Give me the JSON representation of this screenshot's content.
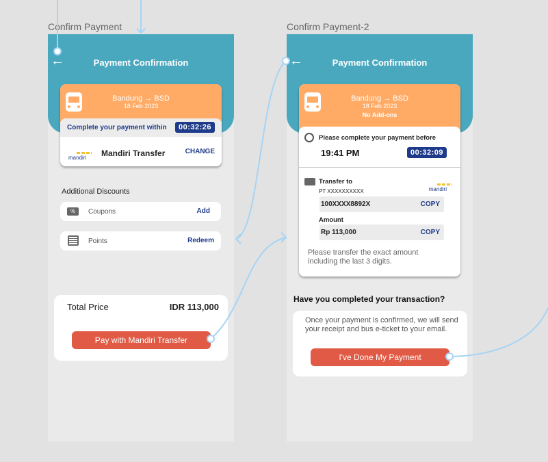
{
  "frames": [
    {
      "title": "Confirm Payment",
      "header": "Payment Confirmation",
      "route": "Bandung → BSD",
      "date": "18 Feb 2023",
      "countdown_label": "Complete your payment within",
      "countdown": "00:32:26",
      "method": "Mandiri Transfer",
      "bank_logo": "mandiri",
      "change": "CHANGE",
      "discounts_title": "Additional Discounts",
      "coupons": {
        "label": "Coupons",
        "action": "Add"
      },
      "points": {
        "label": "Points",
        "action": "Redeem"
      },
      "total_label": "Total Price",
      "total": "IDR 113,000",
      "pay_button": "Pay with Mandiri Transfer"
    },
    {
      "title": "Confirm Payment-2",
      "header": "Payment Confirmation",
      "route": "Bandung → BSD",
      "date": "18 Feb 2023",
      "addons": "No Add-ons",
      "deadline_label": "Please complete your payment before",
      "deadline": "19:41 PM",
      "countdown": "00:32:09",
      "transfer_to": "Transfer to",
      "recipient": "PT XXXXXXXXXX",
      "bank_logo": "mandiri",
      "account": "100XXXX8892X",
      "copy": "COPY",
      "amount_label": "Amount",
      "amount": "Rp 113,000",
      "note": "Please transfer the exact amount including the last 3 digits.",
      "question": "Have you completed your transaction?",
      "info": "Once your payment is confirmed, we will send your receipt and bus e-ticket to your email.",
      "done_button": "I've Done My Payment"
    }
  ],
  "colors": {
    "header": "#4aa8be",
    "ticket": "#ffab66",
    "accent": "#1e3a8a",
    "button": "#e05a45",
    "connector": "#a6d4f5"
  }
}
